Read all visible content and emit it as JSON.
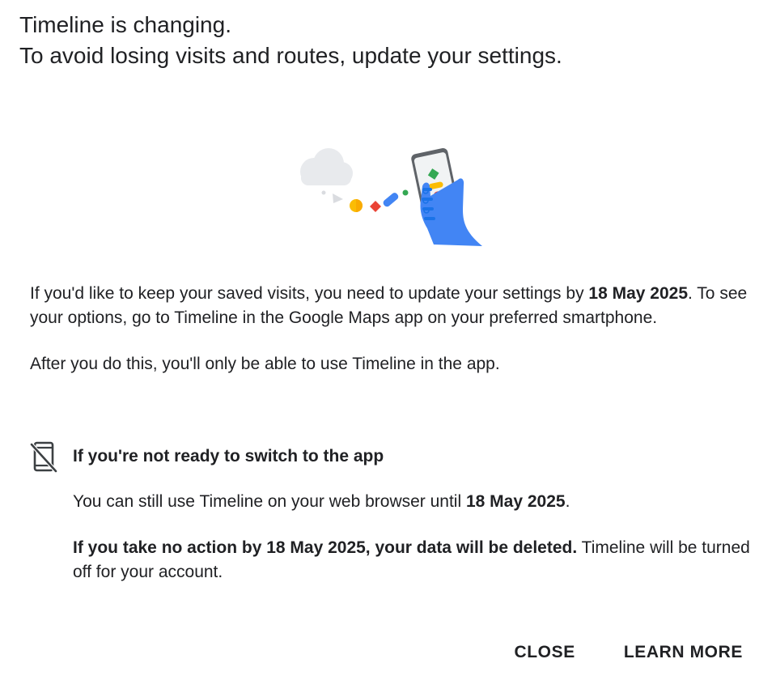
{
  "dialog": {
    "title_line1": "Timeline is changing.",
    "title_line2": "To avoid losing visits and routes, update your settings.",
    "illustration_icon": "cloud-to-phone-illustration",
    "para1_pre": "If you'd like to keep your saved visits, you need to update your settings by ",
    "para1_date": "18 May 2025",
    "para1_post": ". To see your options, go to Timeline in the Google Maps app on your preferred smartphone.",
    "para2": "After you do this, you'll only be able to use Timeline in the app.",
    "notice": {
      "icon": "phone-off-icon",
      "title": "If you're not ready to switch to the app",
      "line1_pre": "You can still use Timeline on your web browser until ",
      "line1_date": "18 May 2025",
      "line1_post": ".",
      "line2_bold": "If you take no action by 18 May 2025, your data will be deleted.",
      "line2_rest": " Timeline will be turned off for your account."
    },
    "buttons": {
      "close_label": "CLOSE",
      "learn_more_label": "LEARN MORE"
    }
  },
  "colors": {
    "text": "#202124",
    "background": "#ffffff",
    "google_blue": "#4285F4",
    "google_red": "#EA4335",
    "google_yellow": "#FBBC04",
    "google_green": "#34A853"
  }
}
